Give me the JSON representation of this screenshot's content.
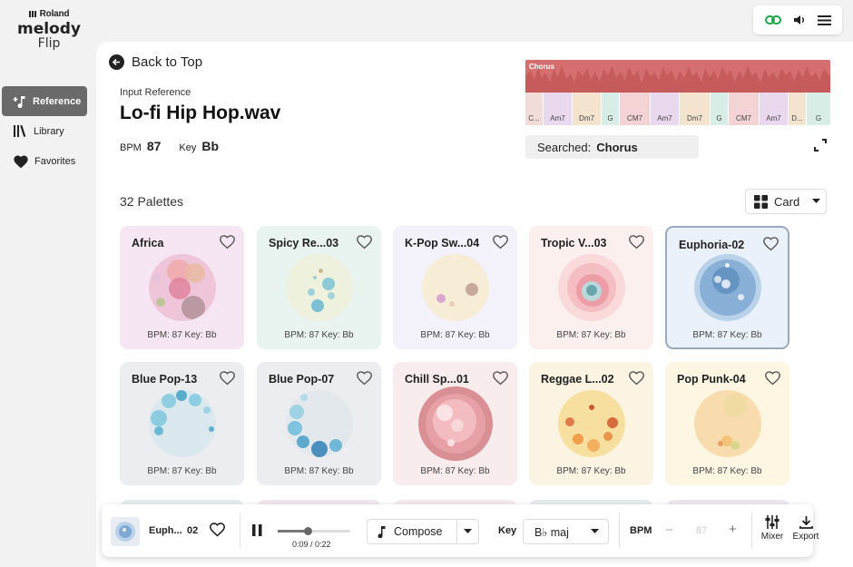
{
  "brand": {
    "maker": "Roland",
    "product_line1": "melody",
    "product_line2": "Flip"
  },
  "nav": [
    {
      "label": "Reference",
      "icon": "music-note-plus-icon",
      "active": true
    },
    {
      "label": "Library",
      "icon": "library-icon",
      "active": false
    },
    {
      "label": "Favorites",
      "icon": "heart-icon",
      "active": false
    }
  ],
  "topbar": {
    "icons": [
      "link-icon",
      "volume-icon",
      "menu-icon"
    ],
    "link_color": "#1fa64a"
  },
  "header": {
    "back_label": "Back to Top",
    "input_label": "Input Reference",
    "song_title": "Lo-fi Hip Hop.wav",
    "bpm_label": "BPM",
    "bpm_value": "87",
    "key_label": "Key",
    "key_value": "Bb"
  },
  "waveform": {
    "section_label": "Chorus",
    "chords": [
      "C...",
      "Am7",
      "Dm7",
      "G",
      "CM7",
      "Am7",
      "Dm7",
      "G",
      "CM7",
      "Am7",
      "D...",
      "G"
    ]
  },
  "search": {
    "label": "Searched:",
    "value": "Chorus"
  },
  "palettes": {
    "count_label": "32 Palettes",
    "view_label": "Card",
    "cards": [
      {
        "name": "Africa",
        "info": "BPM: 87 Key: Bb",
        "bg": "#f6e6f3",
        "selected": false
      },
      {
        "name": "Spicy Re...03",
        "info": "BPM: 87 Key: Bb",
        "bg": "#e9f3f0",
        "selected": false
      },
      {
        "name": "K-Pop Sw...04",
        "info": "BPM: 87 Key: Bb",
        "bg": "#f3f1fa",
        "selected": false
      },
      {
        "name": "Tropic V...03",
        "info": "BPM: 87 Key: Bb",
        "bg": "#fbf0ee",
        "selected": false
      },
      {
        "name": "Euphoria-02",
        "info": "BPM: 87 Key: Bb",
        "bg": "#eaf1fa",
        "selected": true
      },
      {
        "name": "Blue Pop-13",
        "info": "BPM: 87 Key: Bb",
        "bg": "#ebedf0",
        "selected": false
      },
      {
        "name": "Blue Pop-07",
        "info": "BPM: 87 Key: Bb",
        "bg": "#ebedf0",
        "selected": false
      },
      {
        "name": "Chill Sp...01",
        "info": "BPM: 87 Key: Bb",
        "bg": "#f9ecec",
        "selected": false
      },
      {
        "name": "Reggae L...02",
        "info": "BPM: 87 Key: Bb",
        "bg": "#fbf4e2",
        "selected": false
      },
      {
        "name": "Pop Punk-04",
        "info": "BPM: 87 Key: Bb",
        "bg": "#fcf6e3",
        "selected": false
      }
    ]
  },
  "player": {
    "track_name": "Euph...",
    "track_suffix": "02",
    "time": "0:09 / 0:22",
    "progress": 0.41,
    "compose_label": "Compose",
    "key_label": "Key",
    "key_value": "B♭ maj",
    "bpm_label": "BPM",
    "bpm_value": "87",
    "mixer_label": "Mixer",
    "export_label": "Export"
  }
}
